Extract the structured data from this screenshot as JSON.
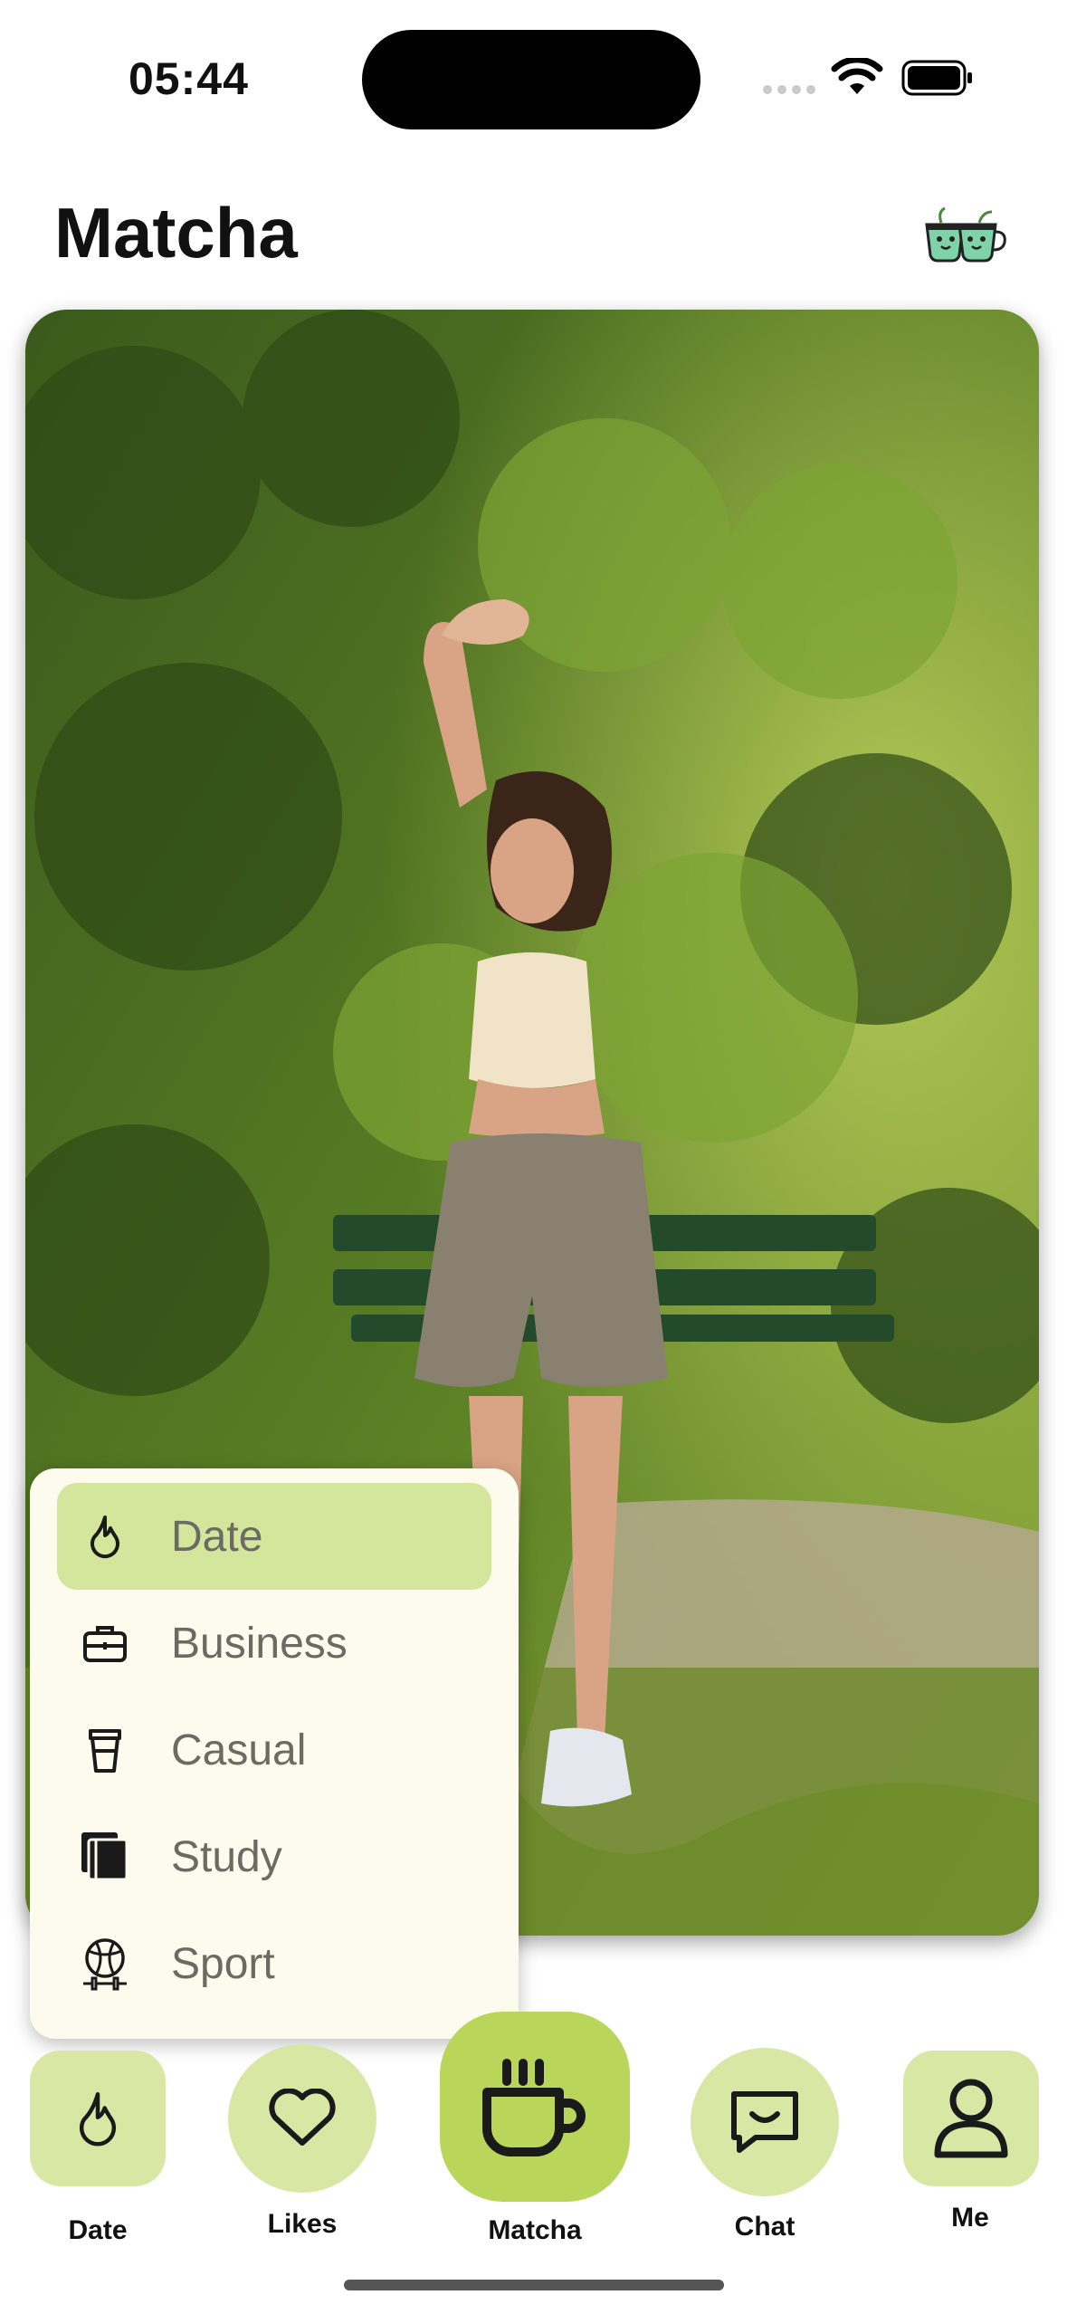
{
  "status_bar": {
    "time": "05:44"
  },
  "header": {
    "title": "Matcha"
  },
  "menu": {
    "items": [
      {
        "label": "Date",
        "icon": "drop-icon",
        "active": true
      },
      {
        "label": "Business",
        "icon": "briefcase-icon",
        "active": false
      },
      {
        "label": "Casual",
        "icon": "cup-icon",
        "active": false
      },
      {
        "label": "Study",
        "icon": "books-icon",
        "active": false
      },
      {
        "label": "Sport",
        "icon": "ball-icon",
        "active": false
      }
    ]
  },
  "bottom_nav": {
    "items": [
      {
        "label": "Date",
        "icon": "drop-icon"
      },
      {
        "label": "Likes",
        "icon": "heart-icon"
      },
      {
        "label": "Matcha",
        "icon": "mug-icon"
      },
      {
        "label": "Chat",
        "icon": "chat-icon"
      },
      {
        "label": "Me",
        "icon": "person-icon"
      }
    ]
  },
  "colors": {
    "menu_bg": "#fdfbee",
    "menu_active": "#d4e59c",
    "nav_bg": "#d8e8a4",
    "nav_center": "#b9d65a"
  }
}
